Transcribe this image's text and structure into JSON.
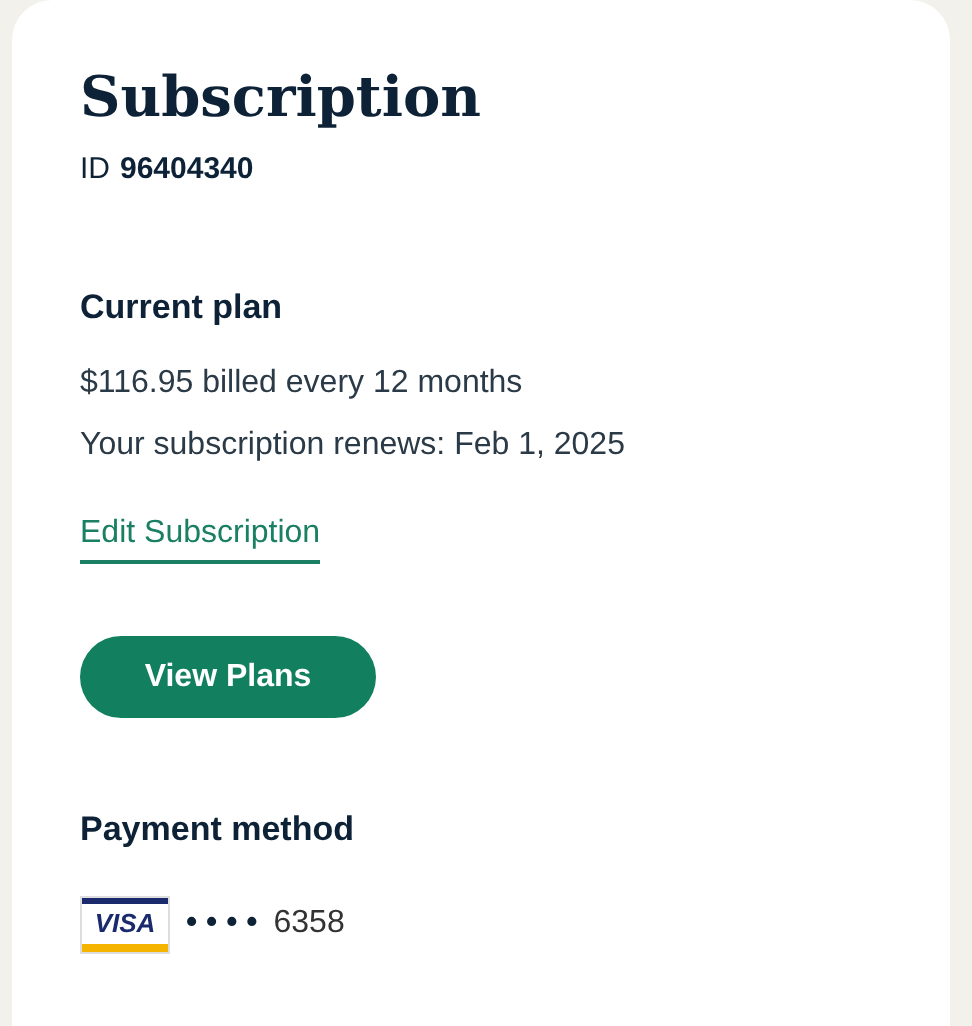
{
  "title": "Subscription",
  "id": {
    "label": "ID",
    "value": "96404340"
  },
  "current_plan": {
    "heading": "Current plan",
    "lines": [
      "$116.95 billed every 12 months",
      "Your subscription renews: Feb 1, 2025"
    ],
    "link": "Edit Subscription",
    "button": "View Plans"
  },
  "payment_method": {
    "heading": "Payment method",
    "card": {
      "brand": "VISA",
      "mask": "• • • •",
      "last4": "6358"
    }
  }
}
